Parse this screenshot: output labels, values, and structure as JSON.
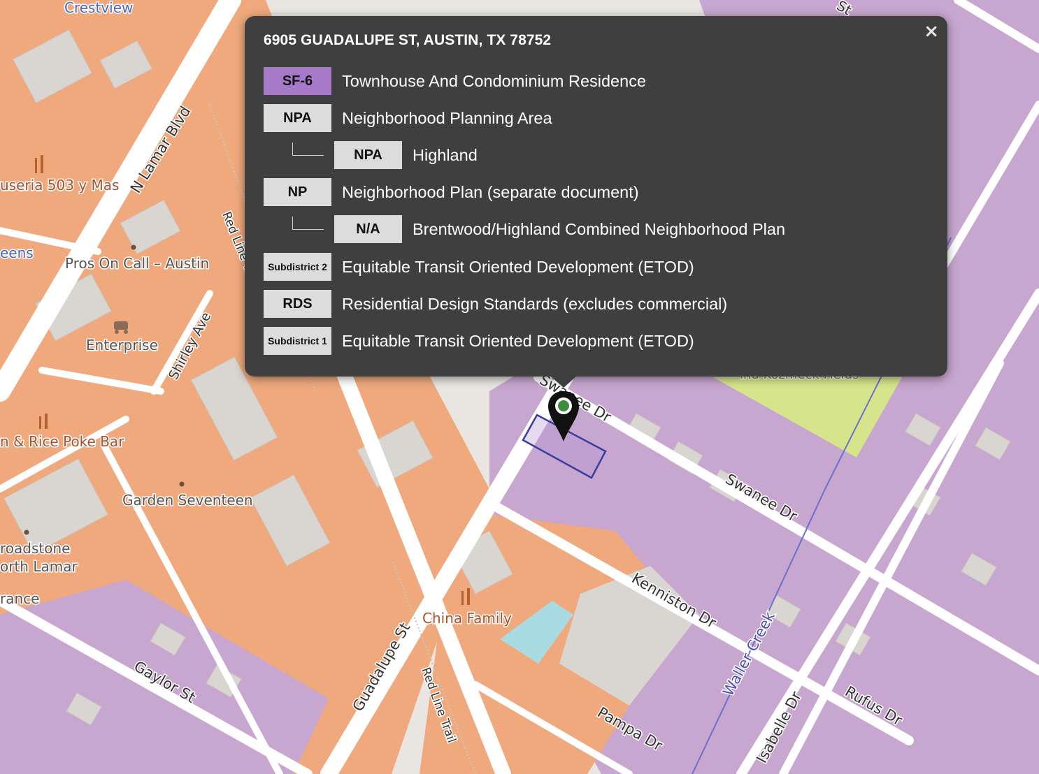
{
  "popup": {
    "title": "6905 GUADALUPE ST, AUSTIN, TX 78752",
    "close_glyph": "×",
    "rows": [
      {
        "badge": "SF-6",
        "text": "Townhouse And Condominium Residence",
        "badge_color": "#a77ac9",
        "indent": false
      },
      {
        "badge": "NPA",
        "text": "Neighborhood Planning Area",
        "indent": false
      },
      {
        "badge": "NPA",
        "text": "Highland",
        "indent": true
      },
      {
        "badge": "NP",
        "text": "Neighborhood Plan (separate document)",
        "indent": false
      },
      {
        "badge": "N/A",
        "text": "Brentwood/Highland Combined Neighborhood Plan",
        "indent": true
      },
      {
        "badge": "Subdistrict 2",
        "text": "Equitable Transit Oriented Development (ETOD)",
        "indent": false
      },
      {
        "badge": "RDS",
        "text": "Residential Design Standards (excludes commercial)",
        "indent": false
      },
      {
        "badge": "Subdistrict 1",
        "text": "Equitable Transit Oriented Development (ETOD)",
        "indent": false
      }
    ]
  },
  "map": {
    "colors": {
      "commercial": "#f0a97d",
      "residential": "#c7a6cf",
      "park": "#d6e48c",
      "water": "#a9dbe3",
      "road": "#ffffff",
      "background": "#e9e6e1",
      "building": "#d9d5d0"
    },
    "street_labels": [
      "N Lamar Blvd",
      "Red Line Trail",
      "Shirley Ave",
      "Guadalupe St",
      "Red Line Trail",
      "Swanee Dr",
      "Swanee Dr",
      "Kenniston Dr",
      "Rufus Dr",
      "Pampa Dr",
      "Isabelle Dr",
      "Gaylor St",
      "Waller Creek"
    ],
    "place_labels": [
      "Crestview",
      "useria 503 y Mas",
      "eens",
      "Pros On Call – Austin",
      "Enterprise",
      "n & Rice Poke Bar",
      "Garden Seventeen",
      "roadstone",
      "orth Lamar",
      "rance",
      "China Family",
      "ind Kozmeck Fields",
      "St"
    ],
    "marker_icon": "map-pin-icon",
    "poi_icons": [
      "restaurant-icon",
      "car-rental-icon",
      "place-dot-icon"
    ]
  }
}
